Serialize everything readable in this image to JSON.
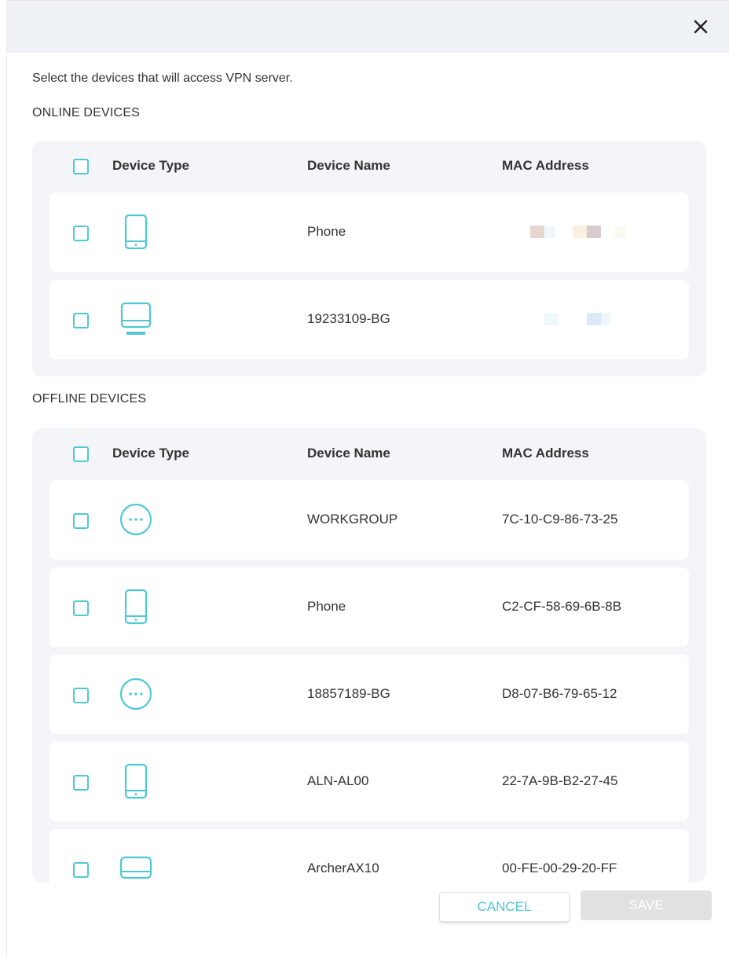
{
  "dialog": {
    "instruction": "Select the devices that will access VPN server.",
    "close_icon": "close-icon"
  },
  "online": {
    "title": "ONLINE DEVICES",
    "columns": {
      "type": "Device Type",
      "name": "Device Name",
      "mac": "MAC Address"
    },
    "devices": [
      {
        "icon": "phone-icon",
        "name": "Phone",
        "mac": ""
      },
      {
        "icon": "computer-icon",
        "name": "19233109-BG",
        "mac": ""
      }
    ]
  },
  "offline": {
    "title": "OFFLINE DEVICES",
    "columns": {
      "type": "Device Type",
      "name": "Device Name",
      "mac": "MAC Address"
    },
    "devices": [
      {
        "icon": "other-device-icon",
        "name": "WORKGROUP",
        "mac": "7C-10-C9-86-73-25"
      },
      {
        "icon": "phone-icon",
        "name": "Phone",
        "mac": "C2-CF-58-69-6B-8B"
      },
      {
        "icon": "other-device-icon",
        "name": "18857189-BG",
        "mac": "D8-07-B6-79-65-12"
      },
      {
        "icon": "phone-icon",
        "name": "ALN-AL00",
        "mac": "22-7A-9B-B2-27-45"
      },
      {
        "icon": "router-icon",
        "name": "ArcherAX10",
        "mac": "00-FE-00-29-20-FF"
      }
    ]
  },
  "footer": {
    "cancel_label": "CANCEL",
    "save_label": "SAVE"
  },
  "colors": {
    "accent": "#4fc8d4",
    "header_bg": "#eef1f5",
    "panel_bg": "#f4f5f8",
    "save_disabled_bg": "#e1e1e1"
  }
}
